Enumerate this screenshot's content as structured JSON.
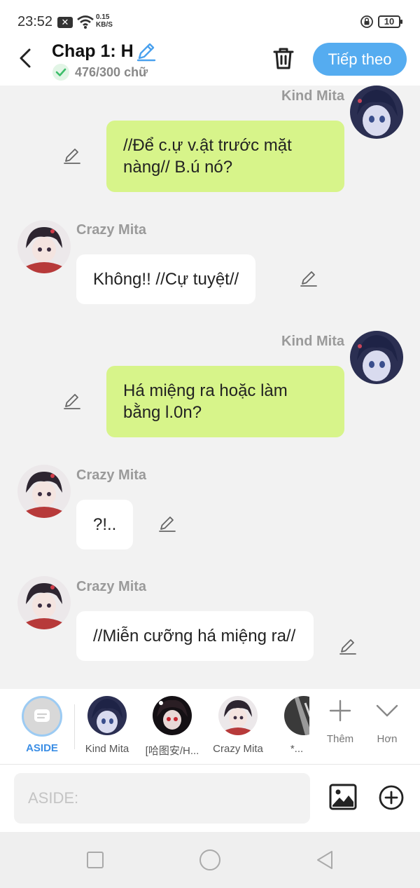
{
  "status_bar": {
    "time": "23:52",
    "net_speed_value": "0.15",
    "net_speed_unit": "KB/S",
    "battery": "10"
  },
  "header": {
    "title": "Chap 1: H",
    "word_count": "476/300 chữ",
    "next_label": "Tiếp theo"
  },
  "messages": [
    {
      "sender": "Kind Mita",
      "text": "//Để c.ự v.ật trước mặt nàng// B.ú nó?",
      "side": "right"
    },
    {
      "sender": "Crazy Mita",
      "text": "Không!! //Cự tuyệt//",
      "side": "left"
    },
    {
      "sender": "Kind Mita",
      "text": "Há miệng ra hoặc làm bằng l.0n?",
      "side": "right"
    },
    {
      "sender": "Crazy Mita",
      "text": "?!..",
      "side": "left"
    },
    {
      "sender": "Crazy Mita",
      "text": "//Miễn cưỡng há miệng ra//",
      "side": "left"
    }
  ],
  "characters": [
    {
      "label": "ASIDE"
    },
    {
      "label": "Kind Mita"
    },
    {
      "label": "[哈图安/H..."
    },
    {
      "label": "Crazy Mita"
    },
    {
      "label": "*..."
    }
  ],
  "tools": {
    "more_label": "Thêm",
    "collapse_label": "Hơn"
  },
  "input": {
    "placeholder": "ASIDE:"
  },
  "colors": {
    "accent": "#55acf0",
    "right_bubble": "#d7f48a",
    "left_bubble": "#ffffff",
    "background": "#f2f2f2"
  }
}
